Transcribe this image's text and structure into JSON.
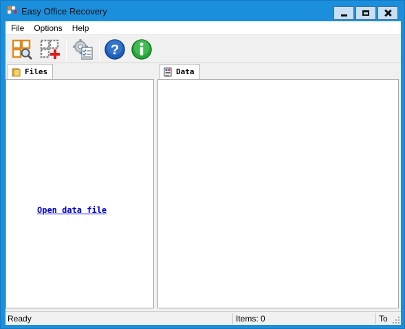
{
  "window": {
    "title": "Easy Office Recovery"
  },
  "menu": {
    "items": [
      "File",
      "Options",
      "Help"
    ]
  },
  "toolbar": {
    "buttons": [
      "open-recover-icon",
      "add-file-icon",
      "settings-checklist-icon",
      "help-icon",
      "info-icon"
    ]
  },
  "left_pane": {
    "tab_label": "Files",
    "link": "Open data file"
  },
  "right_pane": {
    "tab_label": "Data"
  },
  "status": {
    "left": "Ready",
    "middle": "Items: 0",
    "right": "To"
  },
  "colors": {
    "titlebar": "#1c8fdc",
    "link": "#0000cc",
    "help_blue": "#1f5fb8",
    "info_green": "#27a63b"
  }
}
